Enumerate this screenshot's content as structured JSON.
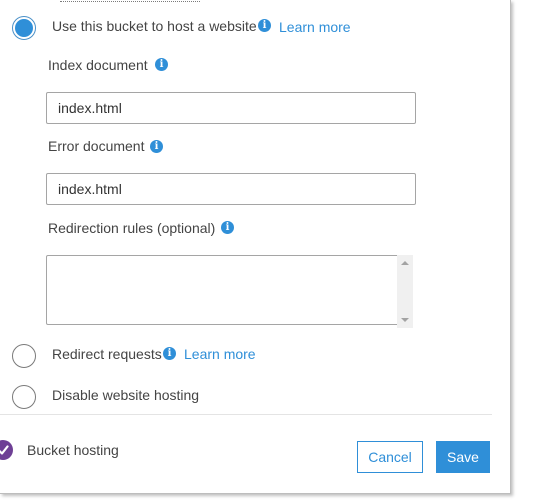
{
  "hosting_options": {
    "use_bucket": {
      "label": "Use this bucket to host a website",
      "learn_more": "Learn more",
      "selected": true
    },
    "redirect": {
      "label": "Redirect requests",
      "learn_more": "Learn more",
      "selected": false
    },
    "disable": {
      "label": "Disable website hosting",
      "selected": false
    }
  },
  "fields": {
    "index_document": {
      "label": "Index document",
      "value": "index.html"
    },
    "error_document": {
      "label": "Error document",
      "value": "index.html"
    },
    "redirection_rules": {
      "label": "Redirection rules (optional)",
      "value": ""
    }
  },
  "footer": {
    "status_label": "Bucket hosting",
    "cancel_label": "Cancel",
    "save_label": "Save"
  },
  "icons": {
    "info": "info-icon",
    "status": "check-circle-icon"
  },
  "colors": {
    "accent": "#2f8fd8",
    "status": "#6e3f95",
    "text": "#444444"
  }
}
